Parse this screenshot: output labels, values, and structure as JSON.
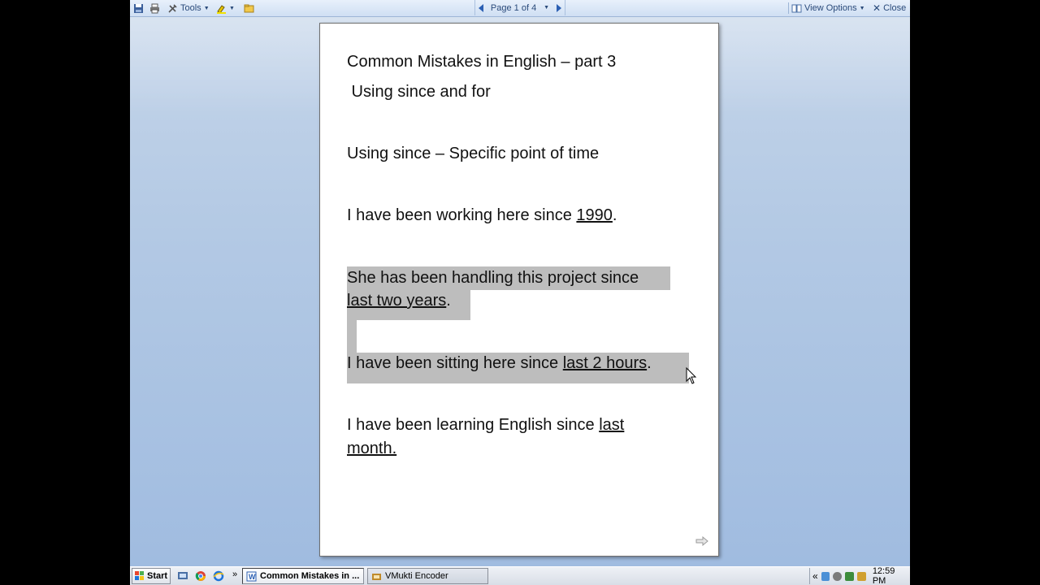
{
  "toolbar": {
    "tools_label": "Tools",
    "page_indicator": "Page 1 of 4",
    "view_options_label": "View Options",
    "close_label": "Close"
  },
  "document": {
    "title": "Common Mistakes in English – part 3",
    "subtitle": " Using since and for",
    "heading": "Using since – Specific point of time",
    "ex1": {
      "pre": "I have been working here since ",
      "u": "1990",
      "post": "."
    },
    "ex2": {
      "line1": "She has been handling this project since",
      "u": "last two years",
      "post": "."
    },
    "ex3": {
      "pre": "I have been sitting here since ",
      "u": "last 2 hours",
      "post": "."
    },
    "ex4": {
      "pre": "I have been learning English since ",
      "u1": "last",
      "u2": "month."
    }
  },
  "taskbar": {
    "start_label": "Start",
    "tasks": [
      {
        "label": "Common Mistakes in ...",
        "active": true
      },
      {
        "label": "VMukti Encoder",
        "active": false
      }
    ],
    "clock": "12:59 PM",
    "tray_chevron": "«"
  },
  "colors": {
    "selection": "#bdbdbd",
    "toolbar_text": "#2a4a7a",
    "background": "#b3c9e4"
  }
}
